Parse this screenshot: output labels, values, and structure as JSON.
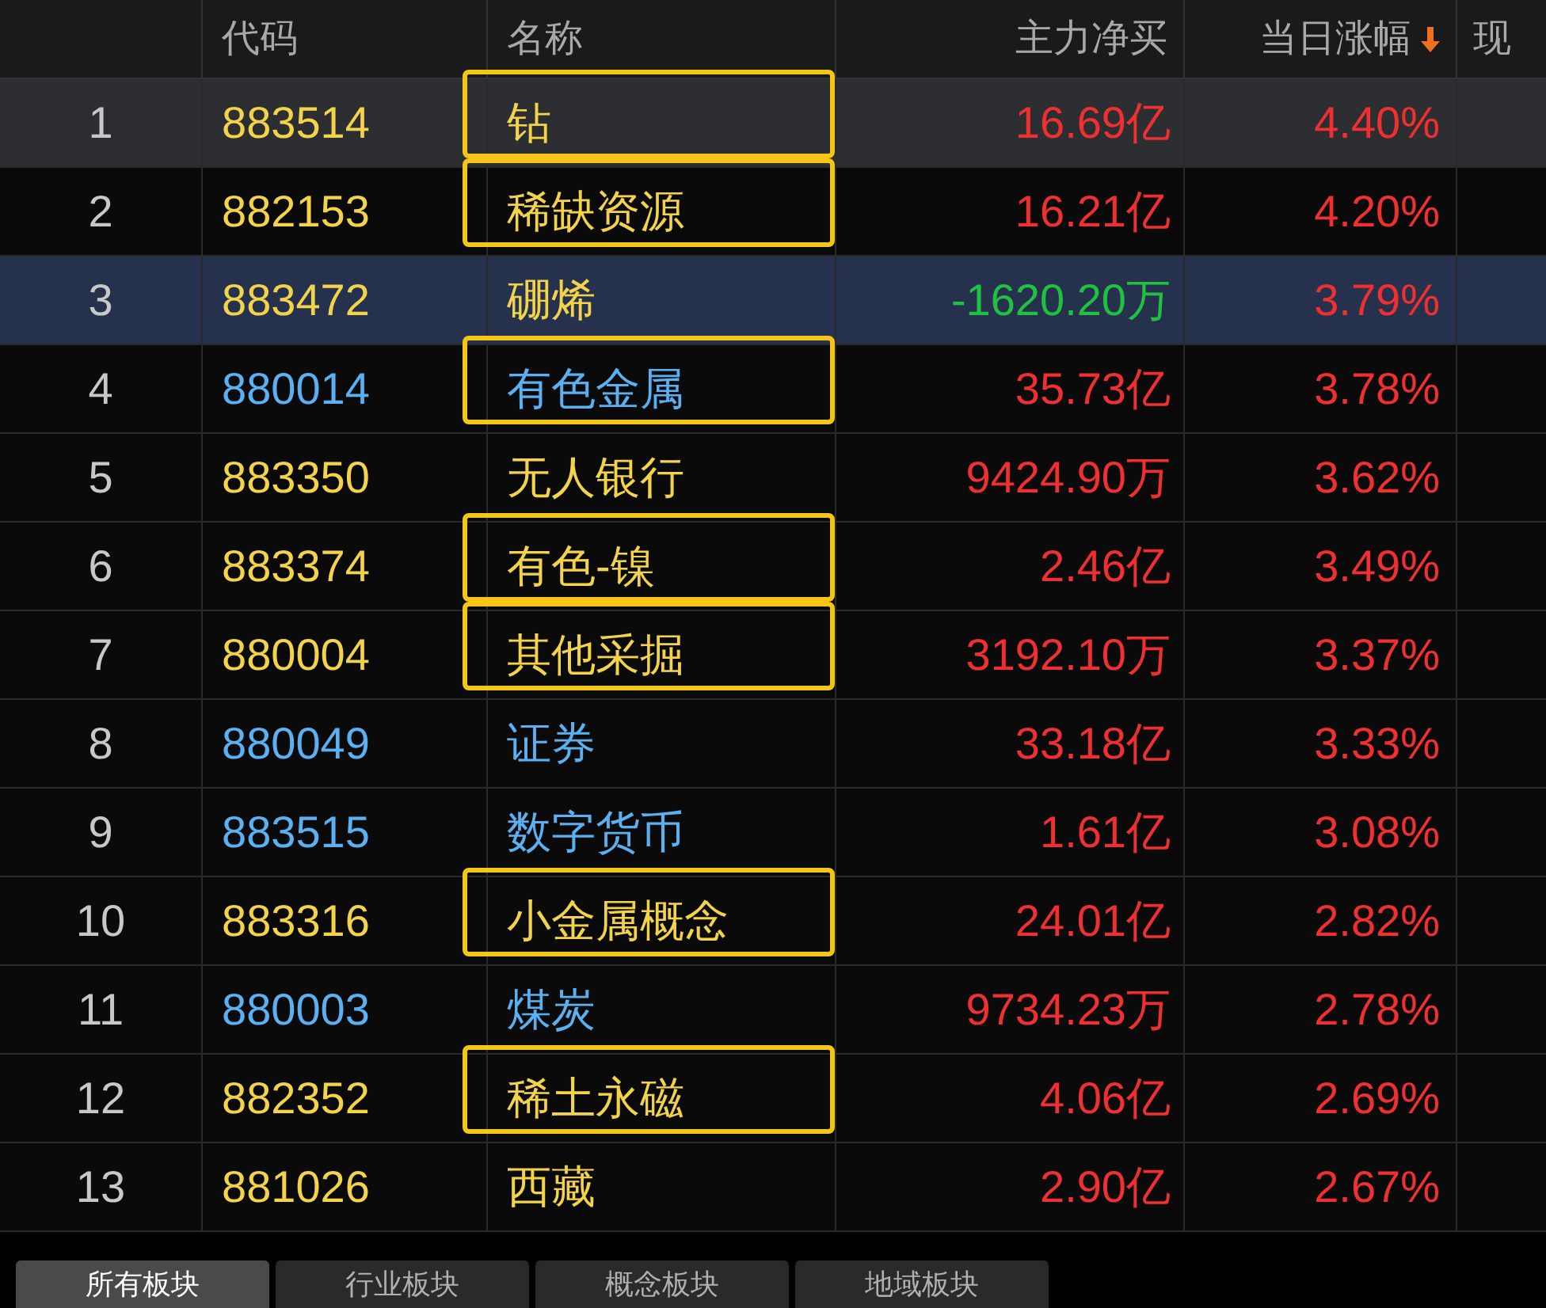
{
  "table": {
    "columns": [
      {
        "label": "代码"
      },
      {
        "label": "名称"
      },
      {
        "label": "主力净买"
      },
      {
        "label": "当日涨幅",
        "sorted_descending": true
      },
      {
        "label": "现"
      }
    ],
    "rows": [
      {
        "index": "1",
        "code": "883514",
        "name": "钻",
        "net_buy": "16.69亿",
        "negative": false,
        "change": "4.40%",
        "color": "#f2d34a",
        "active": true,
        "selected": false,
        "boxed": true
      },
      {
        "index": "2",
        "code": "882153",
        "name": "稀缺资源",
        "net_buy": "16.21亿",
        "negative": false,
        "change": "4.20%",
        "color": "#f2d34a",
        "active": false,
        "selected": false,
        "boxed": true
      },
      {
        "index": "3",
        "code": "883472",
        "name": "硼烯",
        "net_buy": "-1620.20万",
        "negative": true,
        "change": "3.79%",
        "color": "#f2d34a",
        "active": false,
        "selected": true,
        "boxed": false
      },
      {
        "index": "4",
        "code": "880014",
        "name": "有色金属",
        "net_buy": "35.73亿",
        "negative": false,
        "change": "3.78%",
        "color": "#5ab0f0",
        "active": false,
        "selected": false,
        "boxed": true
      },
      {
        "index": "5",
        "code": "883350",
        "name": "无人银行",
        "net_buy": "9424.90万",
        "negative": false,
        "change": "3.62%",
        "color": "#f2d34a",
        "active": false,
        "selected": false,
        "boxed": false
      },
      {
        "index": "6",
        "code": "883374",
        "name": "有色-镍",
        "net_buy": "2.46亿",
        "negative": false,
        "change": "3.49%",
        "color": "#f2d34a",
        "active": false,
        "selected": false,
        "boxed": true
      },
      {
        "index": "7",
        "code": "880004",
        "name": "其他采掘",
        "net_buy": "3192.10万",
        "negative": false,
        "change": "3.37%",
        "color": "#f2d34a",
        "active": false,
        "selected": false,
        "boxed": true
      },
      {
        "index": "8",
        "code": "880049",
        "name": "证券",
        "net_buy": "33.18亿",
        "negative": false,
        "change": "3.33%",
        "color": "#5ab0f0",
        "active": false,
        "selected": false,
        "boxed": false
      },
      {
        "index": "9",
        "code": "883515",
        "name": "数字货币",
        "net_buy": "1.61亿",
        "negative": false,
        "change": "3.08%",
        "color": "#5ab0f0",
        "active": false,
        "selected": false,
        "boxed": false
      },
      {
        "index": "10",
        "code": "883316",
        "name": "小金属概念",
        "net_buy": "24.01亿",
        "negative": false,
        "change": "2.82%",
        "color": "#f2d34a",
        "active": false,
        "selected": false,
        "boxed": true
      },
      {
        "index": "11",
        "code": "880003",
        "name": "煤炭",
        "net_buy": "9734.23万",
        "negative": false,
        "change": "2.78%",
        "color": "#5ab0f0",
        "active": false,
        "selected": false,
        "boxed": false
      },
      {
        "index": "12",
        "code": "882352",
        "name": "稀土永磁",
        "net_buy": "4.06亿",
        "negative": false,
        "change": "2.69%",
        "color": "#f2d34a",
        "active": false,
        "selected": false,
        "boxed": true
      },
      {
        "index": "13",
        "code": "881026",
        "name": "西藏",
        "net_buy": "2.90亿",
        "negative": false,
        "change": "2.67%",
        "color": "#f2d34a",
        "active": false,
        "selected": false,
        "boxed": false
      }
    ]
  },
  "tabs": [
    {
      "label": "所有板块",
      "selected": true
    },
    {
      "label": "行业板块",
      "selected": false
    },
    {
      "label": "概念板块",
      "selected": false
    },
    {
      "label": "地域板块",
      "selected": false
    }
  ]
}
